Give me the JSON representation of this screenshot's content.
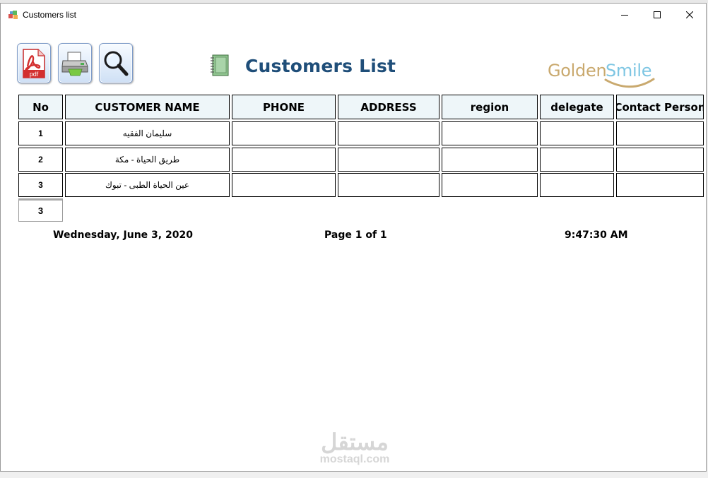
{
  "window": {
    "title": "Customers list",
    "icon": "app-icon"
  },
  "toolbar": [
    {
      "name": "pdf-export-button",
      "icon": "pdf-icon",
      "label": "pdf"
    },
    {
      "name": "print-button",
      "icon": "printer-icon"
    },
    {
      "name": "preview-button",
      "icon": "magnifier-icon"
    }
  ],
  "report": {
    "title": "Customers List",
    "logo_word1": "Golden",
    "logo_word2": "Smile",
    "logo_colors": {
      "golden": "#c9a96e",
      "smile": "#7ec6e3"
    },
    "title_color": "#1f4e79"
  },
  "table": {
    "columns": [
      "No",
      "CUSTOMER NAME",
      "PHONE",
      "ADDRESS",
      "region",
      "delegate",
      "Contact Person"
    ],
    "rows": [
      {
        "no": "1",
        "name": "سليمان الفقيه",
        "phone": "",
        "address": "",
        "region": "",
        "delegate": "",
        "contact": ""
      },
      {
        "no": "2",
        "name": "طريق الحياة - مكة",
        "phone": "",
        "address": "",
        "region": "",
        "delegate": "",
        "contact": ""
      },
      {
        "no": "3",
        "name": "عين الحياة الطبى - تبوك",
        "phone": "",
        "address": "",
        "region": "",
        "delegate": "",
        "contact": ""
      }
    ],
    "total_count": "3"
  },
  "footer": {
    "date": "Wednesday, June 3, 2020",
    "page": "Page 1 of 1",
    "time": "9:47:30 AM"
  },
  "watermark": {
    "arabic": "مستقل",
    "latin": "mostaql.com"
  }
}
